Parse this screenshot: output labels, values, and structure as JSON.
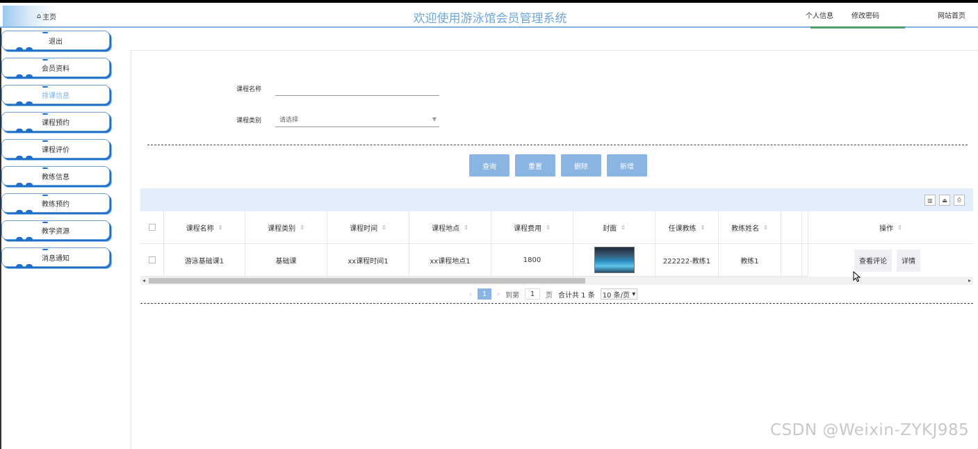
{
  "header": {
    "home_label": "主页",
    "title": "欢迎使用游泳馆会员管理系统",
    "links": [
      "个人信息",
      "修改密码",
      "网站首页"
    ]
  },
  "sidebar": {
    "items": [
      {
        "label": "退出",
        "active": false
      },
      {
        "label": "会员资料",
        "active": false
      },
      {
        "label": "排课信息",
        "active": true
      },
      {
        "label": "课程预约",
        "active": false
      },
      {
        "label": "课程评价",
        "active": false
      },
      {
        "label": "教练信息",
        "active": false
      },
      {
        "label": "教练预约",
        "active": false
      },
      {
        "label": "教学资源",
        "active": false
      },
      {
        "label": "消息通知",
        "active": false
      }
    ]
  },
  "search": {
    "course_name_label": "课程名称",
    "course_name_value": "",
    "course_type_label": "课程类别",
    "course_type_value": "请选择"
  },
  "actions": {
    "query": "查询",
    "reset": "重置",
    "delete": "删除",
    "add": "新增"
  },
  "table": {
    "columns": [
      "课程名称",
      "课程类别",
      "课程时间",
      "课程地点",
      "课程费用",
      "封面",
      "任课教练",
      "教练姓名"
    ],
    "op_column": "操作",
    "rows": [
      {
        "cells": [
          "游泳基础课1",
          "基础课",
          "xx课程时间1",
          "xx课程地点1",
          "1800",
          "",
          "222222-教练1",
          "教练1"
        ],
        "ops": [
          "查看评论",
          "详情"
        ]
      }
    ]
  },
  "pagination": {
    "current_page": "1",
    "goto_label": "到第",
    "goto_value": "1",
    "page_unit": "页",
    "total_text": "合计共 1 条",
    "page_size": "10 条/页"
  },
  "watermark": "CSDN @Weixin-ZYKJ985",
  "colors": {
    "accent": "#8ab4e2",
    "title": "#6fa6d8",
    "toolbar_bg": "#e2eefa"
  }
}
